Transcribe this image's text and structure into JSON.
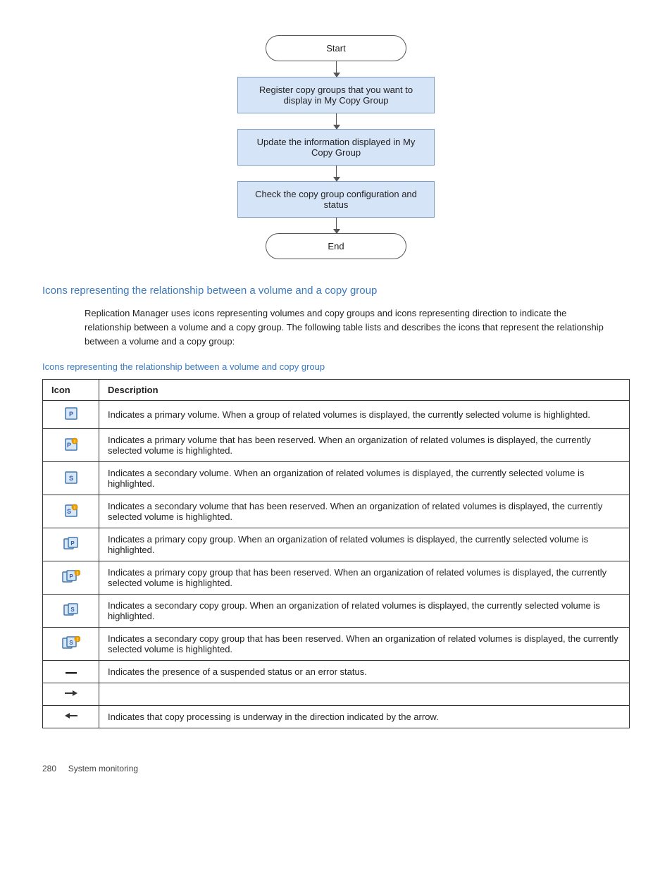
{
  "flowchart": {
    "start_label": "Start",
    "end_label": "End",
    "steps": [
      "Register copy groups that you want to display in My Copy Group",
      "Update the information displayed in My Copy Group",
      "Check the copy group configuration and status"
    ]
  },
  "section_title": "Icons representing the relationship between a volume and a copy group",
  "body_text": "Replication Manager uses icons representing volumes and copy groups and icons representing direction to indicate the relationship between a volume and a copy group. The following table lists and describes the icons that represent the relationship between a volume and a copy group:",
  "sub_link": "Icons representing the relationship between a volume and copy group",
  "table": {
    "headers": [
      "Icon",
      "Description"
    ],
    "rows": [
      {
        "icon_type": "primary-volume",
        "description": "Indicates a primary volume. When a group of related volumes is displayed, the currently selected volume is highlighted."
      },
      {
        "icon_type": "primary-volume-reserved",
        "description": "Indicates a primary volume that has been reserved. When an organization of related volumes is displayed, the currently selected volume is highlighted."
      },
      {
        "icon_type": "secondary-volume",
        "description": "Indicates a secondary volume. When an organization of related volumes is displayed, the currently selected volume is highlighted."
      },
      {
        "icon_type": "secondary-volume-reserved",
        "description": "Indicates a secondary volume that has been reserved. When an organization of related volumes is displayed, the currently selected volume is highlighted."
      },
      {
        "icon_type": "primary-copy-group",
        "description": "Indicates a primary copy group. When an organization of related volumes is displayed, the currently selected volume is highlighted."
      },
      {
        "icon_type": "primary-copy-group-reserved",
        "description": "Indicates a primary copy group that has been reserved. When an organization of related volumes is displayed, the currently selected volume is highlighted."
      },
      {
        "icon_type": "secondary-copy-group",
        "description": "Indicates a secondary copy group. When an organization of related volumes is displayed, the currently selected volume is highlighted."
      },
      {
        "icon_type": "secondary-copy-group-reserved",
        "description": "Indicates a secondary copy group that has been reserved. When an organization of related volumes is displayed, the currently selected volume is highlighted."
      },
      {
        "icon_type": "dash",
        "description": "Indicates the presence of a suspended status or an error status."
      },
      {
        "icon_type": "arrow-right",
        "description": ""
      },
      {
        "icon_type": "arrow-left",
        "description": "Indicates that copy processing is underway in the direction indicated by the arrow."
      }
    ]
  },
  "footer": {
    "page_number": "280",
    "page_text": "System monitoring"
  }
}
